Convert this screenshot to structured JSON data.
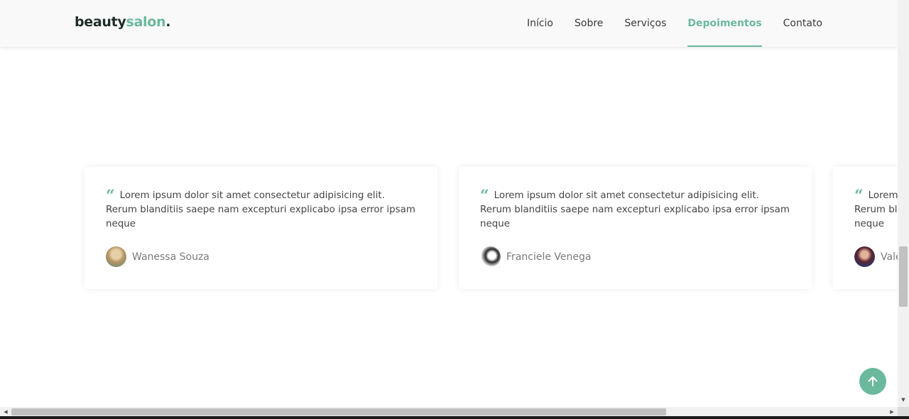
{
  "brand": {
    "name_main": "beauty",
    "name_accent": "salon",
    "name_dot": ".",
    "accent_color": "#6bb99c"
  },
  "nav": {
    "items": [
      {
        "label": "Início",
        "active": false
      },
      {
        "label": "Sobre",
        "active": false
      },
      {
        "label": "Serviços",
        "active": false
      },
      {
        "label": "Depoimentos",
        "active": true
      },
      {
        "label": "Contato",
        "active": false
      }
    ]
  },
  "testimonials": [
    {
      "quote_icon": "“",
      "text": "Lorem ipsum dolor sit amet consectetur adipisicing elit. Rerum blanditiis saepe nam excepturi explicabo ipsa error ipsam neque",
      "author": "Wanessa Souza",
      "avatar": "avatar-photo-blonde-woman"
    },
    {
      "quote_icon": "“",
      "text": "Lorem ipsum dolor sit amet consectetur adipisicing elit. Rerum blanditiis saepe nam excepturi explicabo ipsa error ipsam neque",
      "author": "Franciele Venega",
      "avatar": "avatar-photo-black-white-woman"
    },
    {
      "quote_icon": "“",
      "text": "Lorem ipsum dolor sit amet consectetur adipisicing elit. Rerum blanditiis saepe nam excepturi explicabo ipsa error ipsam neque",
      "author": "Valeria",
      "avatar": "avatar-photo-dark-hair-woman"
    }
  ],
  "back_to_top": {
    "icon": "arrow-up-icon"
  },
  "scrollbars": {
    "up_arrow": "▲",
    "down_arrow": "▼",
    "left_arrow": "◀",
    "right_arrow": "▶"
  }
}
